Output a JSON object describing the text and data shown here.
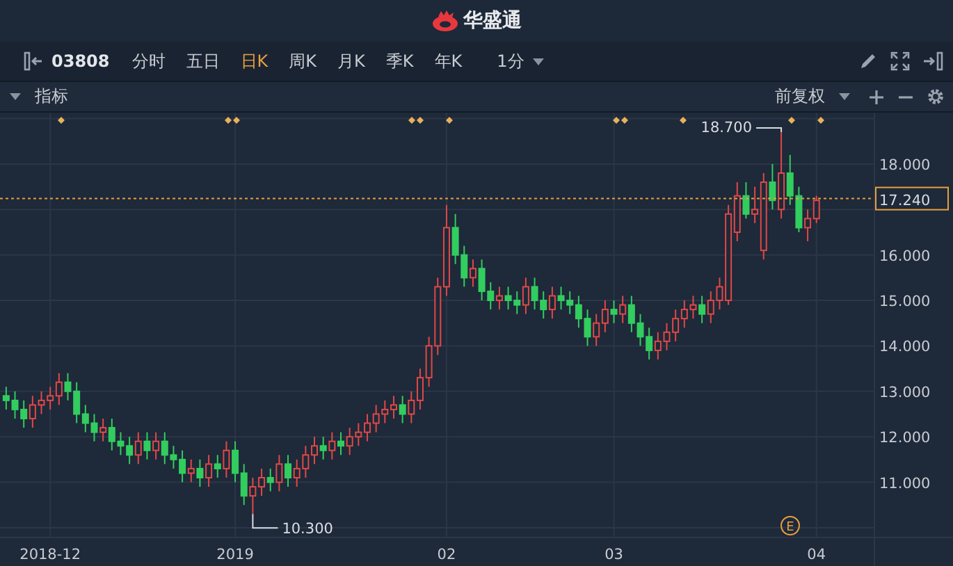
{
  "header": {
    "brand": "华盛通"
  },
  "toolbar": {
    "code": "03808",
    "periods": [
      {
        "label": "分时",
        "selected": false
      },
      {
        "label": "五日",
        "selected": false
      },
      {
        "label": "日K",
        "selected": true
      },
      {
        "label": "周K",
        "selected": false
      },
      {
        "label": "月K",
        "selected": false
      },
      {
        "label": "季K",
        "selected": false
      },
      {
        "label": "年K",
        "selected": false
      }
    ],
    "interval": "1分"
  },
  "indicator_bar": {
    "label": "指标",
    "adjust": "前复权"
  },
  "chart": {
    "high_label": "18.700",
    "low_label": "10.300",
    "event_badge": "E",
    "chart_data": {
      "type": "candlestick",
      "ylim": [
        9.8,
        19.13
      ],
      "grid": true,
      "ref_lines": [
        {
          "axis": "y",
          "value": 17.24,
          "label": "17.240",
          "color": "#e8a040"
        }
      ],
      "yticks": [
        {
          "value": 18,
          "label": "18.000"
        },
        {
          "value": 16,
          "label": "16.000"
        },
        {
          "value": 15,
          "label": "15.000"
        },
        {
          "value": 14,
          "label": "14.000"
        },
        {
          "value": 13,
          "label": "13.000"
        },
        {
          "value": 12,
          "label": "12.000"
        },
        {
          "value": 11,
          "label": "11.000"
        }
      ],
      "categories": [
        null,
        null,
        null,
        null,
        null,
        "2018-12",
        null,
        null,
        null,
        null,
        null,
        null,
        null,
        null,
        null,
        null,
        null,
        null,
        null,
        null,
        null,
        null,
        null,
        null,
        null,
        null,
        "2019",
        null,
        null,
        null,
        null,
        null,
        null,
        null,
        null,
        null,
        null,
        null,
        null,
        null,
        null,
        null,
        null,
        null,
        null,
        null,
        null,
        null,
        null,
        null,
        "02",
        null,
        null,
        null,
        null,
        null,
        null,
        null,
        null,
        null,
        null,
        null,
        null,
        null,
        null,
        null,
        null,
        null,
        null,
        "03",
        null,
        null,
        null,
        null,
        null,
        null,
        null,
        null,
        null,
        null,
        null,
        null,
        null,
        null,
        null,
        null,
        null,
        null,
        null,
        null,
        null,
        null,
        "04"
      ],
      "ohlc": [
        [
          12.9,
          13.1,
          12.6,
          12.8
        ],
        [
          12.8,
          13.0,
          12.4,
          12.6
        ],
        [
          12.6,
          12.8,
          12.2,
          12.4
        ],
        [
          12.4,
          12.9,
          12.2,
          12.7
        ],
        [
          12.7,
          13.0,
          12.5,
          12.8
        ],
        [
          12.8,
          13.1,
          12.6,
          12.9
        ],
        [
          12.9,
          13.4,
          12.7,
          13.2
        ],
        [
          13.2,
          13.4,
          12.8,
          13.0
        ],
        [
          13.0,
          13.2,
          12.3,
          12.5
        ],
        [
          12.5,
          12.7,
          12.1,
          12.3
        ],
        [
          12.3,
          12.5,
          11.9,
          12.1
        ],
        [
          12.1,
          12.4,
          11.9,
          12.2
        ],
        [
          12.2,
          12.4,
          11.7,
          11.9
        ],
        [
          11.9,
          12.1,
          11.6,
          11.8
        ],
        [
          11.8,
          12.0,
          11.4,
          11.6
        ],
        [
          11.6,
          12.1,
          11.4,
          11.9
        ],
        [
          11.9,
          12.1,
          11.5,
          11.7
        ],
        [
          11.7,
          12.1,
          11.5,
          11.9
        ],
        [
          11.9,
          12.1,
          11.4,
          11.6
        ],
        [
          11.6,
          11.8,
          11.3,
          11.5
        ],
        [
          11.5,
          11.7,
          11.0,
          11.2
        ],
        [
          11.2,
          11.5,
          11.0,
          11.3
        ],
        [
          11.3,
          11.5,
          10.9,
          11.1
        ],
        [
          11.1,
          11.6,
          10.9,
          11.4
        ],
        [
          11.4,
          11.6,
          11.1,
          11.3
        ],
        [
          11.3,
          11.9,
          11.1,
          11.7
        ],
        [
          11.7,
          11.9,
          11.0,
          11.2
        ],
        [
          11.2,
          11.4,
          10.5,
          10.7
        ],
        [
          10.7,
          11.1,
          10.3,
          10.9
        ],
        [
          10.9,
          11.3,
          10.7,
          11.1
        ],
        [
          11.1,
          11.3,
          10.8,
          11.0
        ],
        [
          11.0,
          11.6,
          10.8,
          11.4
        ],
        [
          11.4,
          11.6,
          10.9,
          11.1
        ],
        [
          11.1,
          11.5,
          10.9,
          11.3
        ],
        [
          11.3,
          11.8,
          11.1,
          11.6
        ],
        [
          11.6,
          12.0,
          11.4,
          11.8
        ],
        [
          11.8,
          12.0,
          11.5,
          11.7
        ],
        [
          11.7,
          12.1,
          11.5,
          11.9
        ],
        [
          11.9,
          12.1,
          11.6,
          11.8
        ],
        [
          11.8,
          12.2,
          11.6,
          12.0
        ],
        [
          12.0,
          12.3,
          11.8,
          12.1
        ],
        [
          12.1,
          12.5,
          11.9,
          12.3
        ],
        [
          12.3,
          12.7,
          12.1,
          12.5
        ],
        [
          12.5,
          12.8,
          12.3,
          12.6
        ],
        [
          12.6,
          12.9,
          12.4,
          12.7
        ],
        [
          12.7,
          12.9,
          12.3,
          12.5
        ],
        [
          12.5,
          13.0,
          12.3,
          12.8
        ],
        [
          12.8,
          13.5,
          12.6,
          13.3
        ],
        [
          13.3,
          14.2,
          13.1,
          14.0
        ],
        [
          14.0,
          15.5,
          13.8,
          15.3
        ],
        [
          15.3,
          17.1,
          15.1,
          16.6
        ],
        [
          16.6,
          16.9,
          15.8,
          16.0
        ],
        [
          16.0,
          16.2,
          15.3,
          15.5
        ],
        [
          15.5,
          15.9,
          15.3,
          15.7
        ],
        [
          15.7,
          15.9,
          15.0,
          15.2
        ],
        [
          15.2,
          15.4,
          14.8,
          15.0
        ],
        [
          15.0,
          15.3,
          14.8,
          15.1
        ],
        [
          15.1,
          15.3,
          14.8,
          15.0
        ],
        [
          15.0,
          15.2,
          14.7,
          14.9
        ],
        [
          14.9,
          15.5,
          14.7,
          15.3
        ],
        [
          15.3,
          15.5,
          14.8,
          15.0
        ],
        [
          15.0,
          15.2,
          14.6,
          14.8
        ],
        [
          14.8,
          15.3,
          14.6,
          15.1
        ],
        [
          15.1,
          15.3,
          14.8,
          15.0
        ],
        [
          15.0,
          15.2,
          14.7,
          14.9
        ],
        [
          14.9,
          15.1,
          14.4,
          14.6
        ],
        [
          14.6,
          14.8,
          14.0,
          14.2
        ],
        [
          14.2,
          14.7,
          14.0,
          14.5
        ],
        [
          14.5,
          15.0,
          14.3,
          14.8
        ],
        [
          14.8,
          15.0,
          14.5,
          14.7
        ],
        [
          14.7,
          15.1,
          14.5,
          14.9
        ],
        [
          14.9,
          15.1,
          14.3,
          14.5
        ],
        [
          14.5,
          14.7,
          14.0,
          14.2
        ],
        [
          14.2,
          14.4,
          13.7,
          13.9
        ],
        [
          13.9,
          14.3,
          13.7,
          14.1
        ],
        [
          14.1,
          14.5,
          13.9,
          14.3
        ],
        [
          14.3,
          14.8,
          14.1,
          14.6
        ],
        [
          14.6,
          15.0,
          14.4,
          14.8
        ],
        [
          14.8,
          15.1,
          14.6,
          14.9
        ],
        [
          14.9,
          15.1,
          14.5,
          14.7
        ],
        [
          14.7,
          15.2,
          14.5,
          15.0
        ],
        [
          15.0,
          15.5,
          14.8,
          15.3
        ],
        [
          15.0,
          17.1,
          14.9,
          16.9
        ],
        [
          16.5,
          17.6,
          16.3,
          17.3
        ],
        [
          17.3,
          17.6,
          16.8,
          16.9
        ],
        [
          16.9,
          17.5,
          16.7,
          17.0
        ],
        [
          16.1,
          17.8,
          15.9,
          17.6
        ],
        [
          17.6,
          18.0,
          17.0,
          17.2
        ],
        [
          17.0,
          18.7,
          16.8,
          17.8
        ],
        [
          17.8,
          18.2,
          17.1,
          17.3
        ],
        [
          17.3,
          17.5,
          16.5,
          16.6
        ],
        [
          16.6,
          17.0,
          16.3,
          16.8
        ],
        [
          16.8,
          17.3,
          16.7,
          17.2
        ]
      ]
    }
  }
}
